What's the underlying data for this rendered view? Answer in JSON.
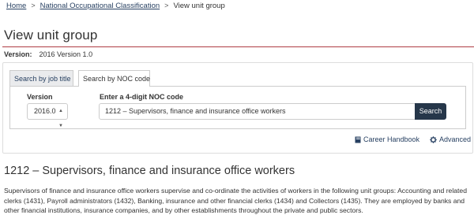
{
  "breadcrumb": {
    "home": "Home",
    "noc": "National Occupational Classification",
    "current": "View unit group",
    "separator": ">"
  },
  "page": {
    "title": "View unit group",
    "version_label": "Version:",
    "version_value": "2016 Version 1.0"
  },
  "tabs": [
    {
      "label": "Search by job title",
      "active": false
    },
    {
      "label": "Search by NOC code",
      "active": true
    }
  ],
  "search": {
    "version_label": "Version",
    "version_selected": "2016.0",
    "noc_label": "Enter a 4-digit NOC code",
    "noc_value": "1212 – Supervisors, finance and insurance office workers",
    "button_label": "Search"
  },
  "links": {
    "career_handbook": "Career Handbook",
    "advanced": "Advanced"
  },
  "unit_group": {
    "heading": "1212 – Supervisors, finance and insurance office workers",
    "description": "Supervisors of finance and insurance office workers supervise and co-ordinate the activities of workers in the following unit groups: Accounting and related clerks (1431), Payroll administrators (1432), Banking, insurance and other financial clerks (1434) and Collectors (1435). They are employed by banks and other financial institutions, insurance companies, and by other establishments throughout the private and public sectors."
  },
  "colors": {
    "link": "#284162",
    "accent_rule": "#af3c43",
    "button": "#26374a"
  }
}
